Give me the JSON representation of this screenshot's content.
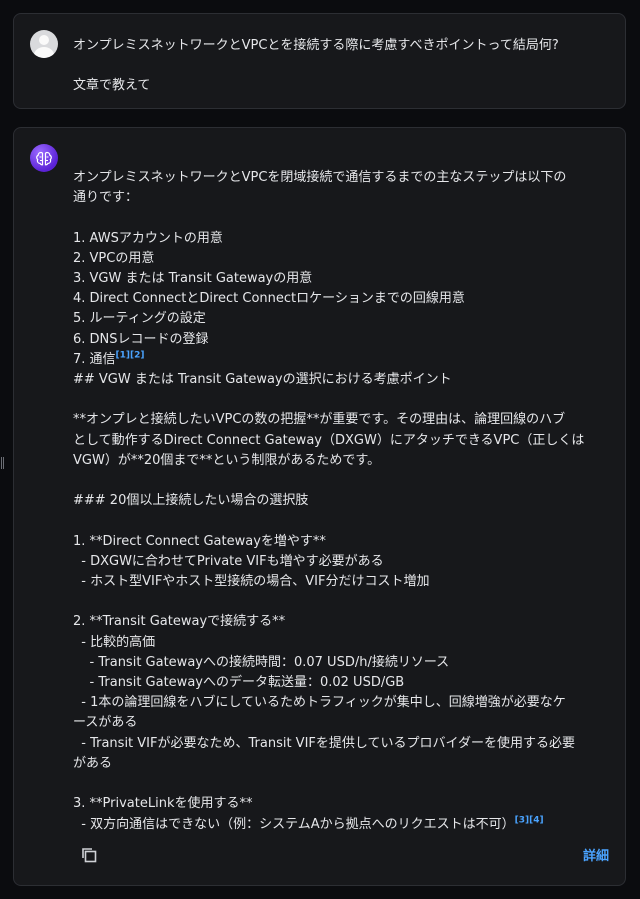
{
  "user_message": {
    "lines": [
      "オンプレミスネットワークとVPCとを接続する際に考慮すべきポイントって結局何?",
      "",
      "文章で教えて"
    ]
  },
  "assistant_message": {
    "l01": "オンプレミスネットワークとVPCを閉域接続で通信するまでの主なステップは以下の",
    "l02": "通りです：",
    "l03": "",
    "l04": "1. AWSアカウントの用意",
    "l05": "2. VPCの用意",
    "l06": "3. VGW または Transit Gatewayの用意",
    "l07": "4. Direct ConnectとDirect Connectロケーションまでの回線用意",
    "l08": "5. ルーティングの設定",
    "l09": "6. DNSレコードの登録",
    "l10": "7. 通信",
    "cite1": "[1]",
    "cite2": "[2]",
    "l11": "## VGW または Transit Gatewayの選択における考慮ポイント",
    "l12": "",
    "l13": "**オンプレと接続したいVPCの数の把握**が重要です。その理由は、論理回線のハブ",
    "l14": "として動作するDirect Connect Gateway（DXGW）にアタッチできるVPC（正しくは",
    "l15": "VGW）が**20個まで**という制限があるためです。",
    "l16": "",
    "l17": "### 20個以上接続したい場合の選択肢",
    "l18": "",
    "l19": "1. **Direct Connect Gatewayを増やす**",
    "l20": "  - DXGWに合わせてPrivate VIFも増やす必要がある",
    "l21": "  - ホスト型VIFやホスト型接続の場合、VIF分だけコスト増加",
    "l22": "",
    "l23": "2. **Transit Gatewayで接続する**",
    "l24": "  - 比較的高価",
    "l25": "    - Transit Gatewayへの接続時間：0.07 USD/h/接続リソース",
    "l26": "    - Transit Gatewayへのデータ転送量：0.02 USD/GB",
    "l27": "  - 1本の論理回線をハブにしているためトラフィックが集中し、回線増強が必要なケ",
    "l28": "ースがある",
    "l29": "  - Transit VIFが必要なため、Transit VIFを提供しているプロバイダーを使用する必要",
    "l30": "がある",
    "l31": "",
    "l32": "3. **PrivateLinkを使用する**",
    "l33": "  - 双方向通信はできない（例：システムAから拠点へのリクエストは不可）",
    "cite3": "[3]",
    "cite4": "[4]"
  },
  "actions": {
    "copy_icon": "copy-icon",
    "detail_label": "詳細"
  },
  "colors": {
    "background": "#0b0c0f",
    "card": "#17181b",
    "border": "#2c2e33",
    "accent": "#4aa3ff",
    "bot_avatar": "#6a2ee8"
  }
}
